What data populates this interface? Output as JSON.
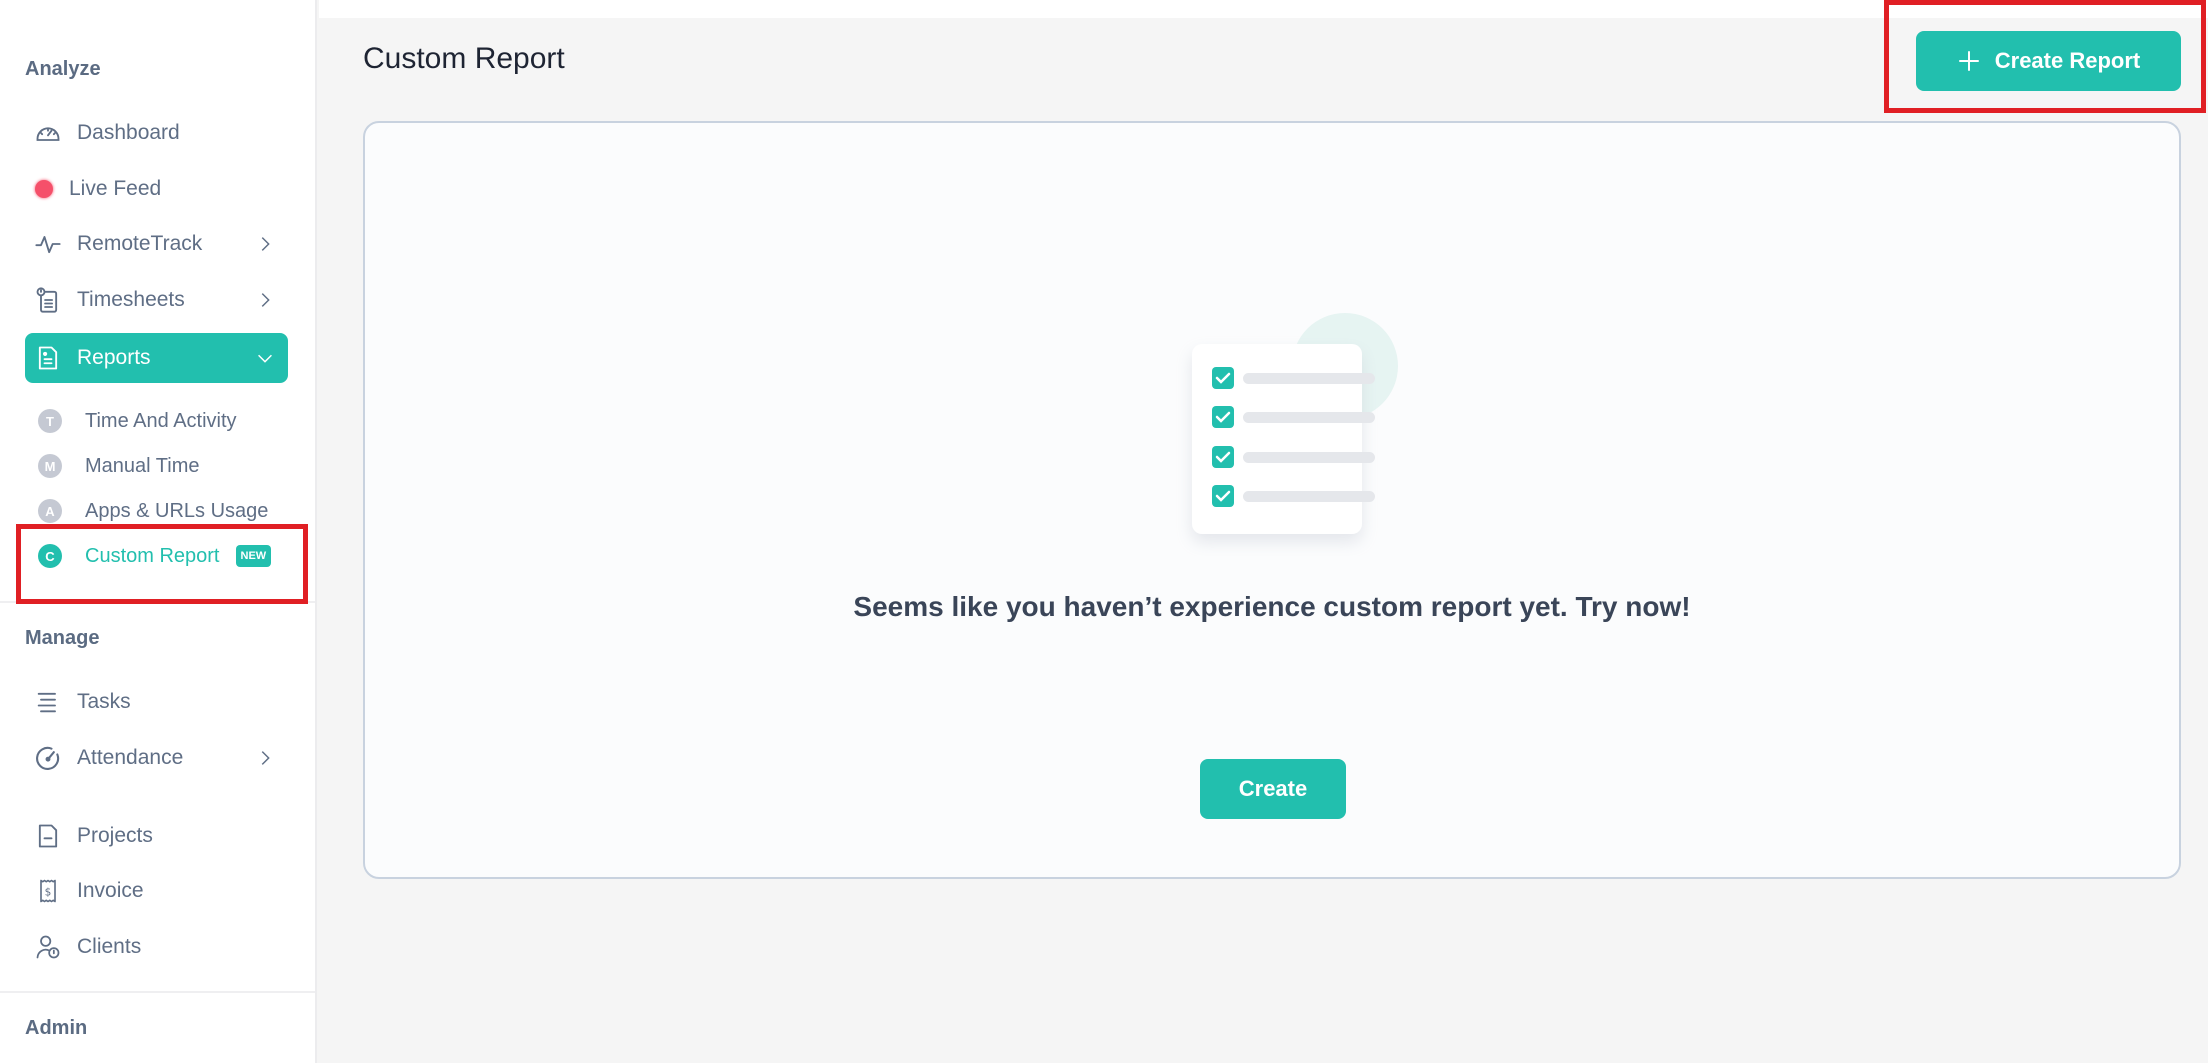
{
  "sidebar": {
    "sections": {
      "analyze": "Analyze",
      "manage": "Manage",
      "admin": "Admin"
    },
    "analyze_items": [
      {
        "label": "Dashboard",
        "icon": "speedometer-icon"
      },
      {
        "label": "Live Feed",
        "icon": "live-dot-icon"
      },
      {
        "label": "RemoteTrack",
        "icon": "pulse-icon",
        "expandable": true
      },
      {
        "label": "Timesheets",
        "icon": "timesheet-icon",
        "expandable": true
      },
      {
        "label": "Reports",
        "icon": "report-doc-icon",
        "expanded": true,
        "active": true
      }
    ],
    "report_subitems": [
      {
        "letter": "T",
        "label": "Time And Activity"
      },
      {
        "letter": "M",
        "label": "Manual Time"
      },
      {
        "letter": "A",
        "label": "Apps & URLs Usage"
      },
      {
        "letter": "C",
        "label": "Custom Report",
        "badge": "NEW",
        "active": true
      }
    ],
    "manage_items": [
      {
        "label": "Tasks",
        "icon": "list-icon"
      },
      {
        "label": "Attendance",
        "icon": "gauge-icon",
        "expandable": true
      },
      {
        "label": "Projects",
        "icon": "document-icon"
      },
      {
        "label": "Invoice",
        "icon": "receipt-icon"
      },
      {
        "label": "Clients",
        "icon": "user-clock-icon"
      }
    ]
  },
  "header": {
    "title": "Custom Report",
    "create_report_label": "Create Report"
  },
  "empty_state": {
    "message": "Seems like you haven’t experience custom report yet. Try now!",
    "create_label": "Create"
  },
  "colors": {
    "accent": "#22bfae",
    "live": "#f5506a",
    "annotation": "#e01f24"
  }
}
